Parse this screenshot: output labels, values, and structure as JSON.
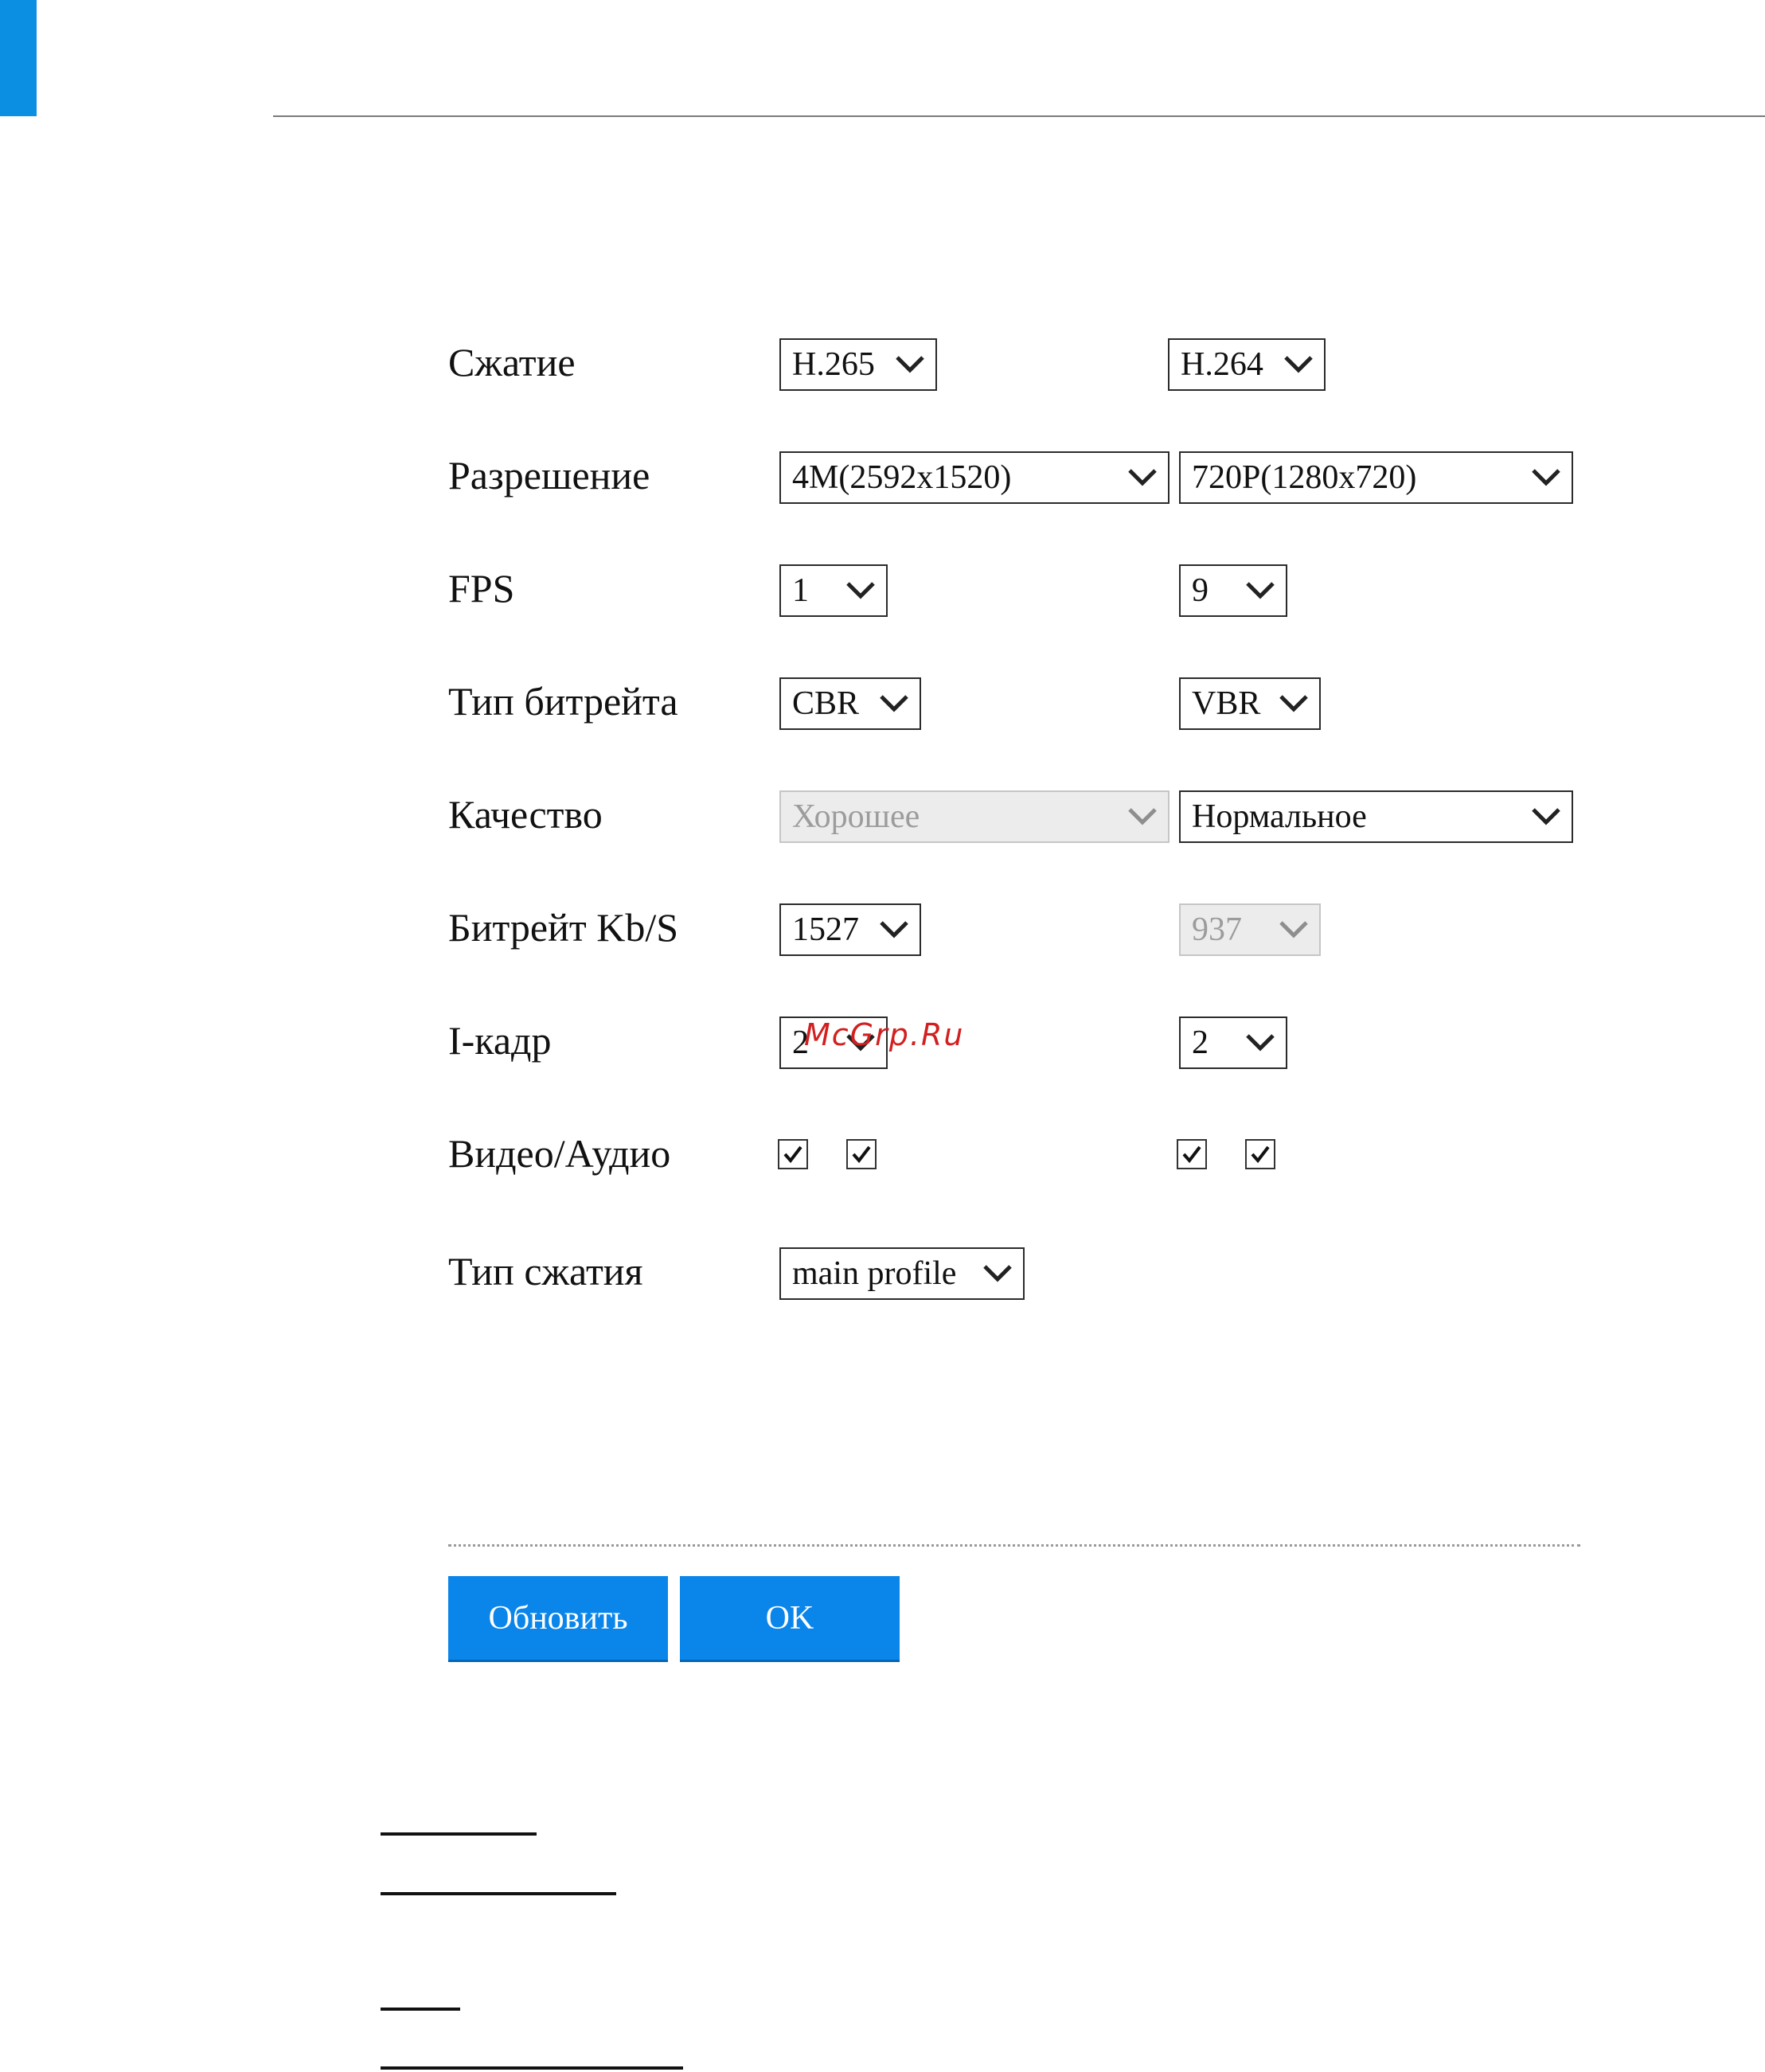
{
  "form": {
    "rows": [
      {
        "label": "Сжатие",
        "ch1": "H.265",
        "ch2": "H.264"
      },
      {
        "label": "Разрешение",
        "ch1": "4M(2592x1520)",
        "ch2": "720P(1280x720)"
      },
      {
        "label": "FPS",
        "ch1": "1",
        "ch2": "9"
      },
      {
        "label": "Тип битрейта",
        "ch1": "CBR",
        "ch2": "VBR"
      },
      {
        "label": "Качество",
        "ch1": "Хорошее",
        "ch2": "Нормальное",
        "ch1_disabled": true
      },
      {
        "label": "Битрейт Kb/S",
        "ch1": "1527",
        "ch2": "937",
        "ch2_disabled": true
      },
      {
        "label": "I-кадр",
        "ch1": "2",
        "ch2": "2"
      },
      {
        "label": "Видео/Аудио",
        "ch1_video": true,
        "ch1_audio": true,
        "ch2_video": true,
        "ch2_audio": true
      },
      {
        "label": "Тип сжатия",
        "ch1": "main profile"
      }
    ]
  },
  "buttons": {
    "refresh": "Обновить",
    "ok": "OK"
  },
  "watermark": "McGrp.Ru",
  "colors": {
    "accent": "#0a85ea",
    "corner": "#0a8fe3"
  }
}
